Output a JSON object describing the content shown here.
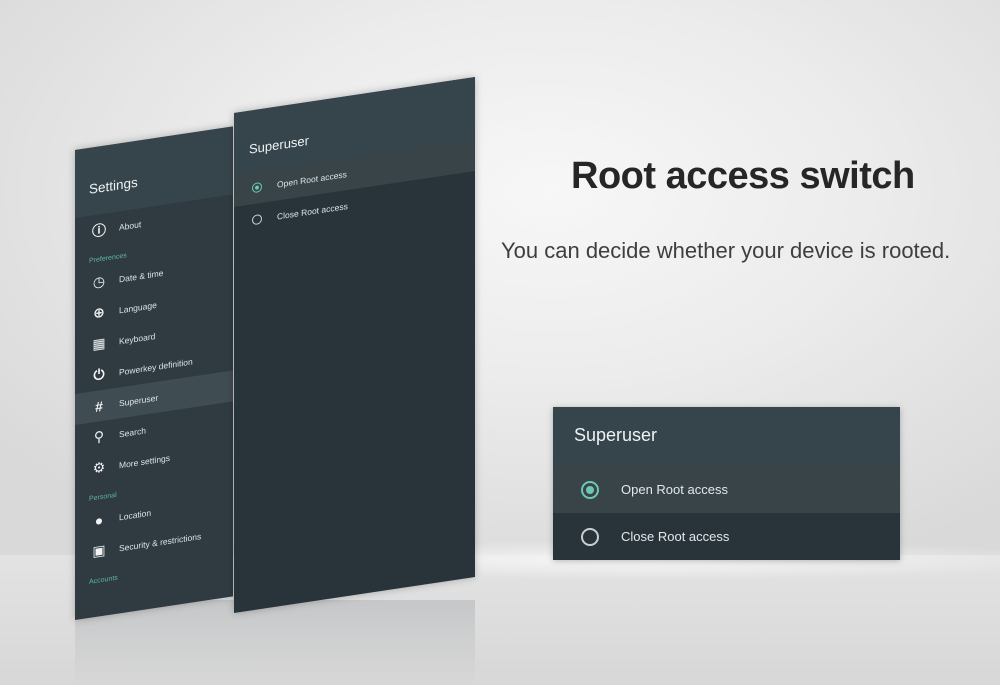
{
  "headline": "Root access switch",
  "subtitle": "You can decide whether your device is rooted.",
  "settings": {
    "title": "Settings",
    "items": [
      {
        "type": "item",
        "label": "About",
        "icon": "info-icon",
        "glyph": "ⓘ"
      },
      {
        "type": "category",
        "label": "Preferences"
      },
      {
        "type": "item",
        "label": "Date & time",
        "icon": "clock-icon",
        "glyph": "◷"
      },
      {
        "type": "item",
        "label": "Language",
        "icon": "globe-icon",
        "glyph": "⊕"
      },
      {
        "type": "item",
        "label": "Keyboard",
        "icon": "keyboard-icon",
        "glyph": "▦"
      },
      {
        "type": "item",
        "label": "Powerkey definition",
        "icon": "power-icon",
        "glyph": "⏻"
      },
      {
        "type": "item",
        "label": "Superuser",
        "icon": "hash-icon",
        "glyph": "#",
        "selected": true
      },
      {
        "type": "item",
        "label": "Search",
        "icon": "search-icon",
        "glyph": "⚲"
      },
      {
        "type": "item",
        "label": "More settings",
        "icon": "gear-icon",
        "glyph": "⚙"
      },
      {
        "type": "category",
        "label": "Personal"
      },
      {
        "type": "item",
        "label": "Location",
        "icon": "location-pin-icon",
        "glyph": "●"
      },
      {
        "type": "item",
        "label": "Security & restrictions",
        "icon": "lock-icon",
        "glyph": "▣"
      },
      {
        "type": "category",
        "label": "Accounts"
      }
    ]
  },
  "superuser": {
    "title": "Superuser",
    "options": [
      {
        "label": "Open Root access",
        "selected": true
      },
      {
        "label": "Close Root access",
        "selected": false
      }
    ]
  },
  "colors": {
    "panel": "#2f3b41",
    "header": "#36454c",
    "accent": "#6cc7b4"
  }
}
